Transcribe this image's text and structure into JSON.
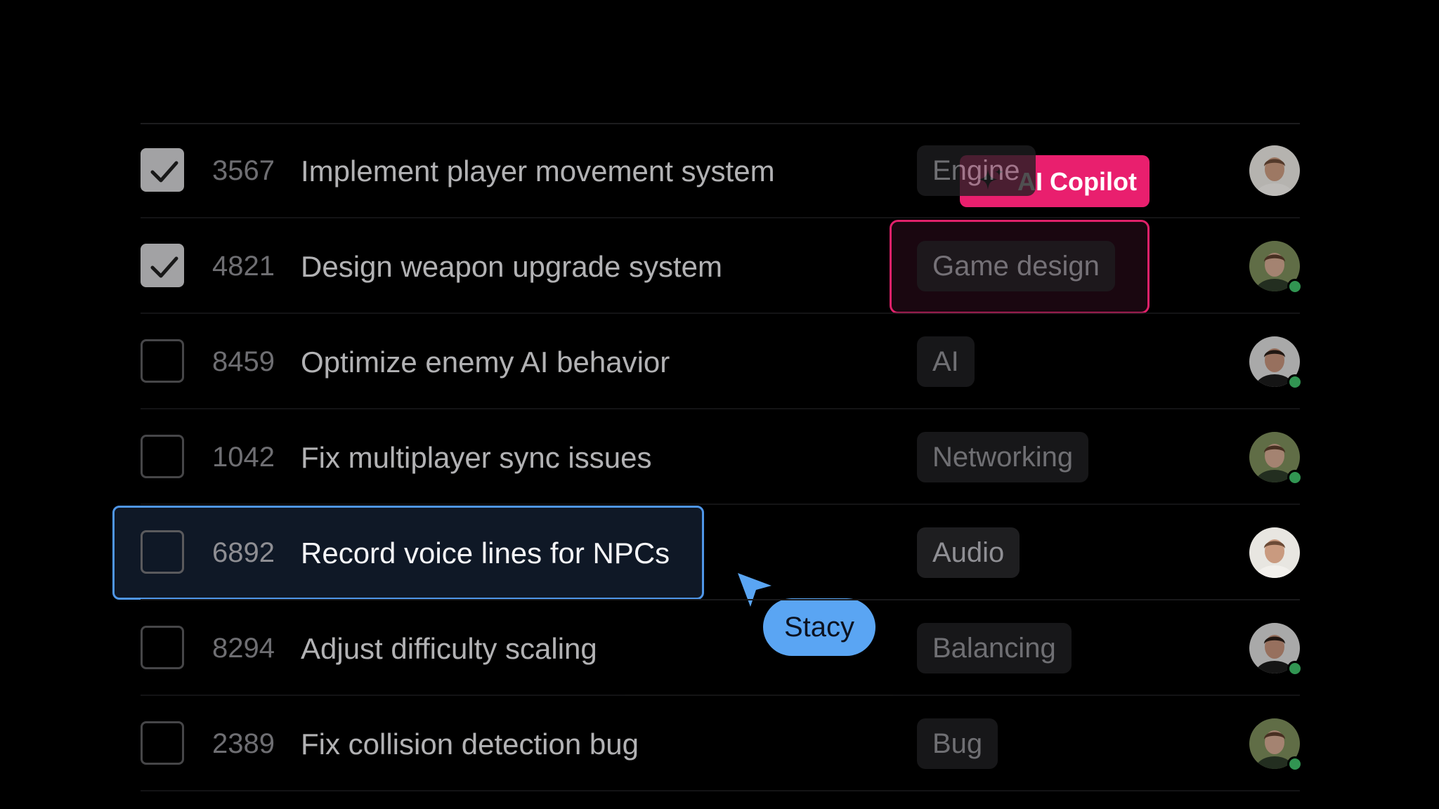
{
  "tasks": [
    {
      "id": "3567",
      "title": "Implement player movement system",
      "tag": "Engine",
      "checked": true,
      "online": false,
      "avatar": "avatar-man-light-beard"
    },
    {
      "id": "4821",
      "title": "Design weapon upgrade system",
      "tag": "Game design",
      "checked": true,
      "online": true,
      "avatar": "avatar-woman-outdoors"
    },
    {
      "id": "8459",
      "title": "Optimize enemy AI behavior",
      "tag": "AI",
      "checked": false,
      "online": true,
      "avatar": "avatar-man-dark-hair"
    },
    {
      "id": "1042",
      "title": "Fix multiplayer sync issues",
      "tag": "Networking",
      "checked": false,
      "online": true,
      "avatar": "avatar-woman-outdoors"
    },
    {
      "id": "6892",
      "title": "Record voice lines for NPCs",
      "tag": "Audio",
      "checked": false,
      "online": false,
      "avatar": "avatar-man-light-beard"
    },
    {
      "id": "8294",
      "title": "Adjust difficulty scaling",
      "tag": "Balancing",
      "checked": false,
      "online": true,
      "avatar": "avatar-man-dark-hair"
    },
    {
      "id": "2389",
      "title": "Fix collision detection bug",
      "tag": "Bug",
      "checked": false,
      "online": true,
      "avatar": "avatar-woman-outdoors"
    }
  ],
  "copilot": {
    "label": "AI Copilot",
    "icon": "sparkle-icon",
    "color": "#e91f6e"
  },
  "cursor": {
    "name": "Stacy",
    "color": "#5aa5f3"
  },
  "colors": {
    "background": "#000000",
    "selection": "#4f96e8",
    "online": "#3fbf6a"
  }
}
